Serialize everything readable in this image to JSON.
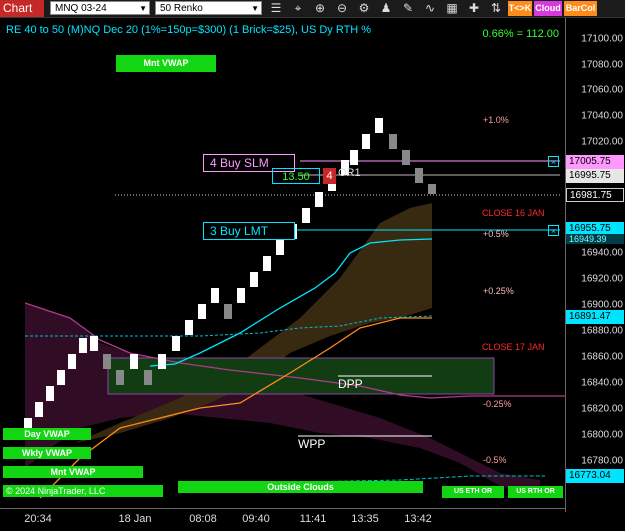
{
  "toolbar": {
    "title": "Chart",
    "instrument": "MNQ 03-24",
    "bar_type": "50 Renko",
    "buttons": {
      "tk": "T<>K",
      "cloud": "Cloud",
      "barcol": "BarCol"
    }
  },
  "header": {
    "title": "RE 40 to 50 (M)NQ Dec 20 (1%=150p=$300) (1 Brick=$25), US Dy RTH %",
    "pct": "0.66% = 112.00"
  },
  "orders": {
    "buy_slm": "4 Buy SLM",
    "buy_lmt": "3 Buy LMT",
    "pnl": "13.50",
    "qty": "4",
    "or_label": "OR1"
  },
  "price_tags": {
    "slm": "17005.75",
    "last": "16995.75",
    "dotted": "16981.75",
    "lmt": "16955.75",
    "lmt_under": "16949.39",
    "cyan_line": "16891.47",
    "bottom": "16773.04"
  },
  "labels": {
    "p1": "+1.0%",
    "p05": "+0.5%",
    "p025": "+0.25%",
    "n025": "-0.25%",
    "n05": "-0.5%",
    "close16": "CLOSE 16 JAN",
    "close17": "CLOSE 17 JAN",
    "dpp": "DPP",
    "wpp": "WPP",
    "mnt_vwap_top": "Mnt VWAP",
    "day_vwap": "Day VWAP",
    "wkly_vwap": "Wkly VWAP",
    "mnt_vwap": "Mnt VWAP",
    "outside_clouds": "Outside Clouds",
    "us_eth": "US ETH OR",
    "us_rth": "US RTH OR",
    "copyright": "© 2024 NinjaTrader, LLC"
  },
  "y_axis": [
    "17100.00",
    "17080.00",
    "17060.00",
    "17040.00",
    "17020.00",
    "16940.00",
    "16920.00",
    "16900.00",
    "16880.00",
    "16860.00",
    "16840.00",
    "16820.00",
    "16800.00",
    "16780.00"
  ],
  "x_axis": [
    "20:34",
    "18 Jan",
    "08:08",
    "09:40",
    "11:41",
    "13:35",
    "13:42"
  ],
  "colors": {
    "accent": "#00e5ff",
    "green": "#12d612",
    "red": "#ff2a2a",
    "magenta": "#ff99ff"
  }
}
